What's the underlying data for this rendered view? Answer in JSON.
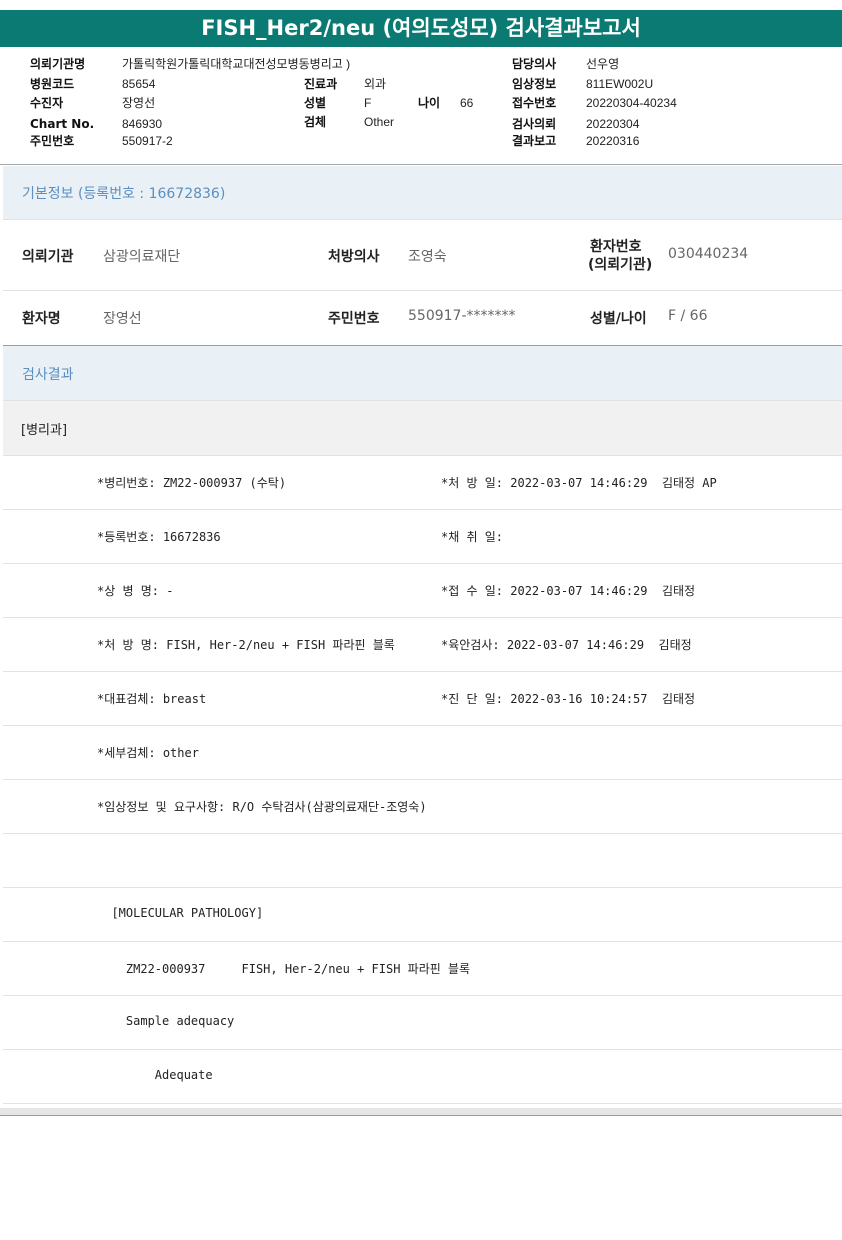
{
  "title": "FISH_Her2/neu (여의도성모) 검사결과보고서",
  "header": {
    "institution_label": "의뢰기관명",
    "institution_value": "가톨릭학원가톨릭대학교대전성모병동병리고 )",
    "hospital_code_label": "병원코드",
    "hospital_code_value": "85654",
    "examinee_label": "수진자",
    "examinee_value": "장영선",
    "chart_no_label": "Chart No.",
    "chart_no_value": "846930",
    "rrn_label": "주민번호",
    "rrn_value": "550917-2",
    "dept_label": "진료과",
    "dept_value": "외과",
    "sex_label": "성별",
    "sex_value": "F",
    "age_label": "나이",
    "age_value": "66",
    "specimen_label": "검체",
    "specimen_value": "Other",
    "doctor_label": "담당의사",
    "doctor_value": "선우영",
    "clinical_label": "임상정보",
    "clinical_value": "811EW002U",
    "receipt_label": "접수번호",
    "receipt_value": "20220304-40234",
    "request_label": "검사의뢰",
    "request_value": "20220304",
    "report_label": "결과보고",
    "report_value": "20220316"
  },
  "basic_info": {
    "heading": "기본정보 (등록번호 : 16672836)",
    "requesting_org_label": "의뢰기관",
    "requesting_org_value": "삼광의료재단",
    "prescriber_label": "처방의사",
    "prescriber_value": "조영숙",
    "patient_no_label_1": "환자번호",
    "patient_no_label_2": "(의뢰기관)",
    "patient_no_value": "030440234",
    "patient_name_label": "환자명",
    "patient_name_value": "장영선",
    "rrn_label": "주민번호",
    "rrn_value": "550917-*******",
    "sex_age_label": "성별/나이",
    "sex_age_value": "F / 66"
  },
  "results": {
    "heading": "검사결과",
    "subheading": "[병리과]",
    "rows": [
      {
        "left": "*병리번호: ZM22-000937 (수탁)",
        "right": "*처 방 일: 2022-03-07 14:46:29  김태정 AP"
      },
      {
        "left": "*등록번호: 16672836",
        "right": "*채 취 일:"
      },
      {
        "left": "*상 병 명: -",
        "right": "*접 수 일: 2022-03-07 14:46:29  김태정"
      },
      {
        "left": "*처 방 명: FISH, Her-2/neu + FISH 파라핀 블록",
        "right": "*육안검사: 2022-03-07 14:46:29  김태정"
      },
      {
        "left": "*대표검체: breast",
        "right": "*진 단 일: 2022-03-16 10:24:57  김태정"
      },
      {
        "left": "*세부검체: other",
        "right": ""
      },
      {
        "left": "*임상정보 및 요구사항: R/O 수탁검사(삼광의료재단-조영숙)",
        "right": ""
      },
      {
        "left": "",
        "right": ""
      },
      {
        "left": "  [MOLECULAR PATHOLOGY]",
        "right": ""
      },
      {
        "left": "    ZM22-000937     FISH, Her-2/neu + FISH 파라핀 블록",
        "right": ""
      },
      {
        "left": "    Sample adequacy",
        "right": ""
      },
      {
        "left": "        Adequate",
        "right": ""
      }
    ]
  }
}
